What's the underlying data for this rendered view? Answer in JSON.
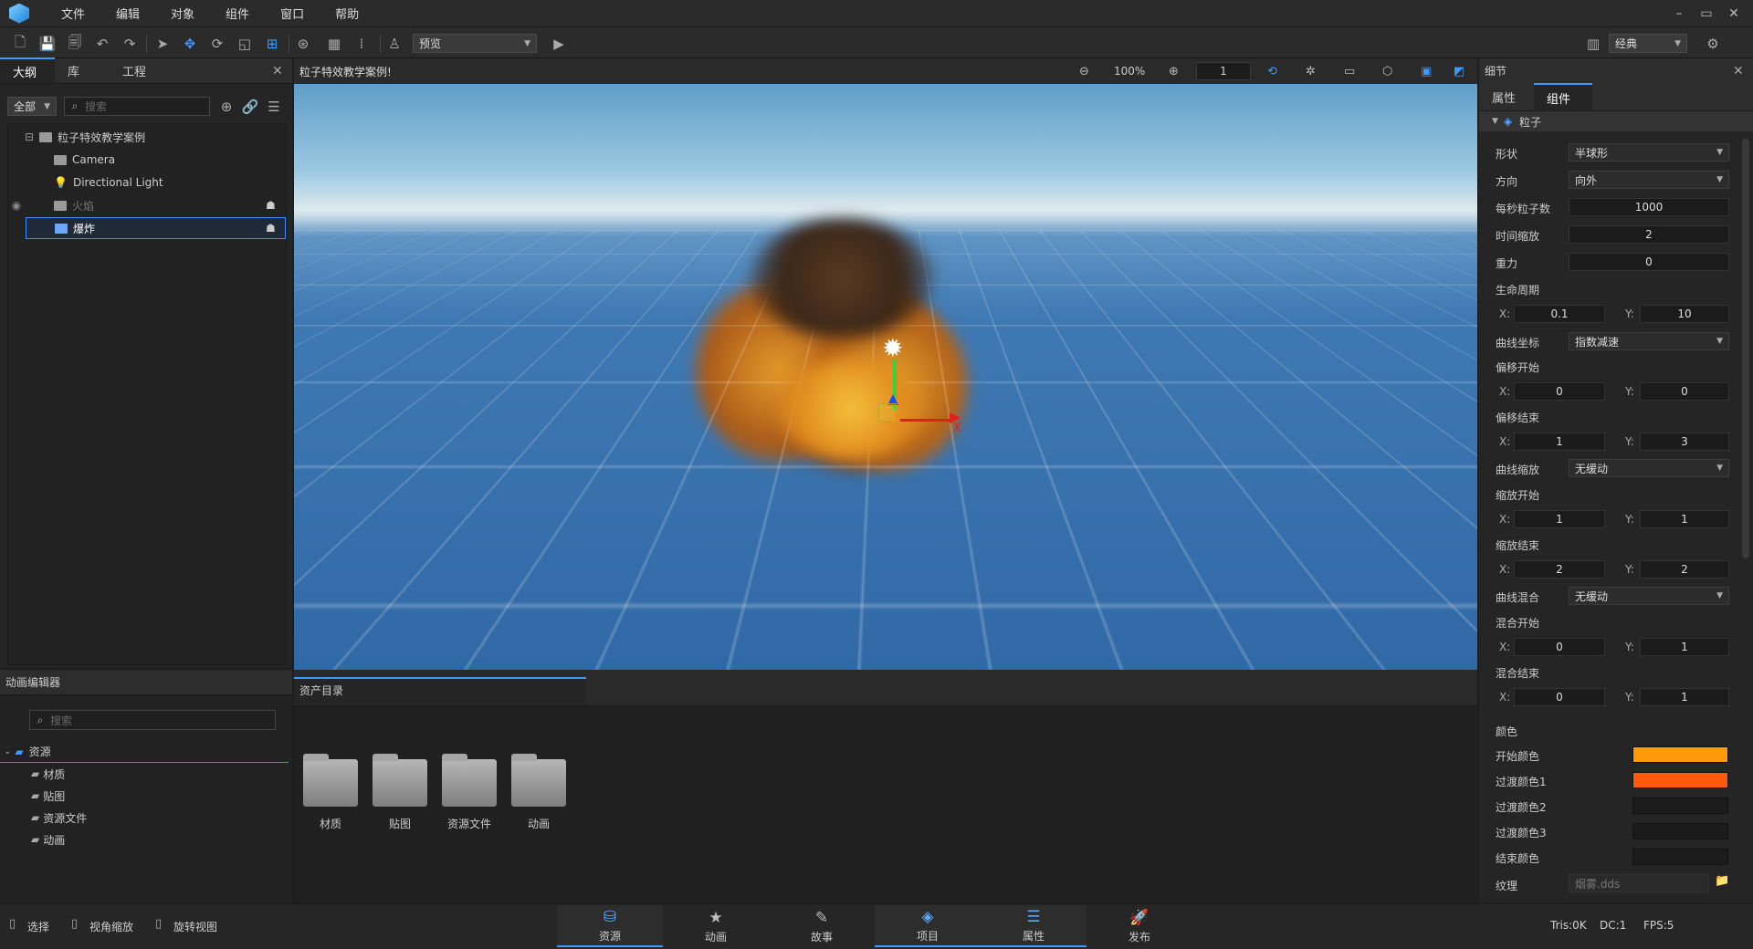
{
  "menu": {
    "items": [
      "文件",
      "编辑",
      "对象",
      "组件",
      "窗口",
      "帮助"
    ],
    "window_controls": [
      "–",
      "▭",
      "✕"
    ]
  },
  "toolbar": {
    "preview_mode": "预览",
    "layout_mode": "经典"
  },
  "outline": {
    "tabs": [
      "大纲",
      "库",
      "工程"
    ],
    "filter": "全部",
    "search_placeholder": "搜索",
    "items": [
      {
        "label": "粒子特效教学案例"
      },
      {
        "label": "Camera"
      },
      {
        "label": "Directional Light"
      },
      {
        "label": "火焰"
      },
      {
        "label": "爆炸"
      }
    ]
  },
  "viewport": {
    "title": "粒子特效教学案例!",
    "zoom": "100%",
    "speed": "1"
  },
  "anim_editor": {
    "title": "动画编辑器",
    "search_placeholder": "搜索",
    "root": "资源",
    "children": [
      "材质",
      "贴图",
      "资源文件",
      "动画"
    ]
  },
  "assets": {
    "tab": "资产目录",
    "folders": [
      "材质",
      "贴图",
      "资源文件",
      "动画"
    ]
  },
  "details": {
    "title": "细节",
    "tabs": [
      "属性",
      "组件"
    ],
    "section": "粒子",
    "shape_label": "形状",
    "shape_value": "半球形",
    "direction_label": "方向",
    "direction_value": "向外",
    "rate_label": "每秒粒子数",
    "rate_value": "1000",
    "timescale_label": "时间缩放",
    "timescale_value": "2",
    "gravity_label": "重力",
    "gravity_value": "0",
    "life_label": "生命周期",
    "life_x": "0.1",
    "life_y": "10",
    "curve_coord_label": "曲线坐标",
    "curve_coord_value": "指数减速",
    "offset_start_label": "偏移开始",
    "offset_start_x": "0",
    "offset_start_y": "0",
    "offset_end_label": "偏移结束",
    "offset_end_x": "1",
    "offset_end_y": "3",
    "curve_scale_label": "曲线缩放",
    "curve_scale_value": "无缓动",
    "scale_start_label": "缩放开始",
    "scale_start_x": "1",
    "scale_start_y": "1",
    "scale_end_label": "缩放结束",
    "scale_end_x": "2",
    "scale_end_y": "2",
    "curve_blend_label": "曲线混合",
    "curve_blend_value": "无缓动",
    "blend_start_label": "混合开始",
    "blend_start_x": "0",
    "blend_start_y": "1",
    "blend_end_label": "混合结束",
    "blend_end_x": "0",
    "blend_end_y": "1",
    "color_header": "颜色",
    "colors": [
      {
        "label": "开始颜色",
        "hex": "#ff9a0a"
      },
      {
        "label": "过渡颜色1",
        "hex": "#ff5a0a"
      },
      {
        "label": "过渡颜色2",
        "hex": "#1c1c1c"
      },
      {
        "label": "过渡颜色3",
        "hex": "#1c1c1c"
      },
      {
        "label": "结束颜色",
        "hex": "#1c1c1c"
      }
    ],
    "texture_label": "纹理",
    "texture_value": "烟雾.dds",
    "x_label": "X:",
    "y_label": "Y:"
  },
  "statusbar": {
    "hints": [
      "选择",
      "视角缩放",
      "旋转视图"
    ],
    "tabs": [
      "资源",
      "动画",
      "故事",
      "项目",
      "属性",
      "发布"
    ],
    "tris": "Tris:0K",
    "dc": "DC:1",
    "fps": "FPS:5"
  }
}
